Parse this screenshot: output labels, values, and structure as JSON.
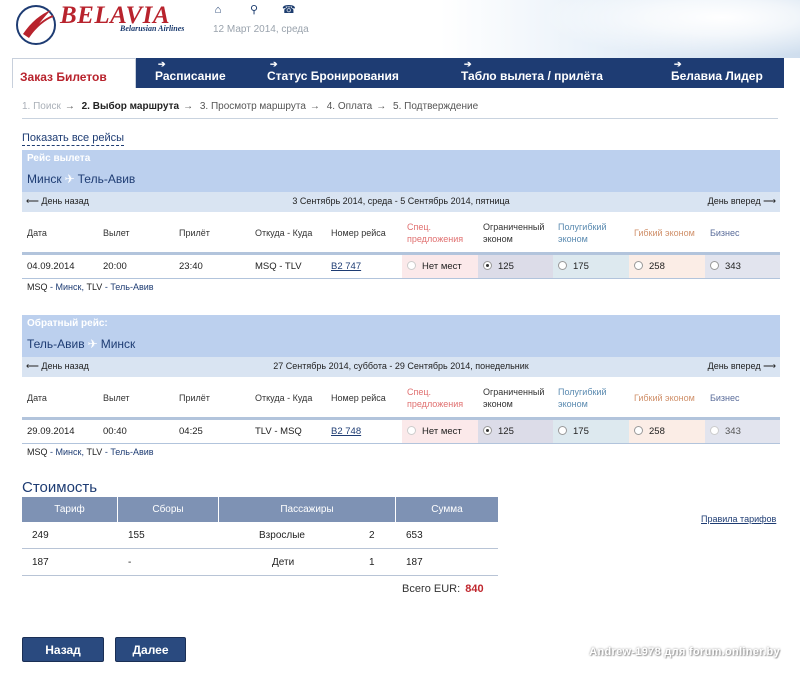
{
  "header": {
    "brand": "BELAVIA",
    "brand_sub": "Belarusian Airlines",
    "date": "12 Март 2014, среда",
    "icons": [
      "home-icon",
      "search-icon",
      "phone-icon"
    ]
  },
  "tabs": [
    {
      "label": "Заказ Билетов",
      "active": true
    },
    {
      "label": "Расписание"
    },
    {
      "label": "Статус Бронирования"
    },
    {
      "label": "Табло вылета / прилёта"
    },
    {
      "label": "Белавиа Лидер"
    }
  ],
  "steps": {
    "s1": "1. Поиск",
    "s2": "2. Выбор маршрута",
    "s3": "3. Просмотр маршрута",
    "s4": "4. Оплата",
    "s5": "5. Подтверждение",
    "arrow": "→"
  },
  "show_all": "Показать все рейсы",
  "columns": {
    "date": "Дата",
    "dep": "Вылет",
    "arr": "Прилёт",
    "from_to": "Откуда - Куда",
    "flight_no": "Номер рейса",
    "spec_1": "Спец.",
    "spec_2": "предложения",
    "ogr_1": "Ограниченный",
    "ogr_2": "эконом",
    "poluf_1": "Полугибкий",
    "poluf_2": "эконом",
    "gibk": "Гибкий эконом",
    "biz": "Бизнес"
  },
  "outbound": {
    "heading": "Рейс вылета",
    "from": "Минск",
    "to": "Тель-Авив",
    "prev": "⟵ День назад",
    "range": "3 Сентябрь 2014, среда - 5 Сентябрь 2014, пятница",
    "next": "День вперед ⟶",
    "row": {
      "date": "04.09.2014",
      "dep": "20:00",
      "arr": "23:40",
      "route": "MSQ - TLV",
      "flight": "B2 747",
      "spec": "Нет мест",
      "ogr": "125",
      "poluf": "175",
      "gibk": "258",
      "biz": "343"
    },
    "foot_a": "MSQ",
    "foot_a_city": "Минск",
    "foot_b": "TLV",
    "foot_b_city": "Тель-Авив"
  },
  "inbound": {
    "heading": "Обратный рейс:",
    "from": "Тель-Авив",
    "to": "Минск",
    "prev": "⟵ День назад",
    "range": "27 Сентябрь 2014, суббота - 29 Сентябрь 2014, понедельник",
    "next": "День вперед ⟶",
    "row": {
      "date": "29.09.2014",
      "dep": "00:40",
      "arr": "04:25",
      "route": "TLV - MSQ",
      "flight": "B2 748",
      "spec": "Нет мест",
      "ogr": "125",
      "poluf": "175",
      "gibk": "258",
      "biz": "343"
    },
    "foot_a": "MSQ",
    "foot_a_city": "Минск",
    "foot_b": "TLV",
    "foot_b_city": "Тель-Авив"
  },
  "cost": {
    "title": "Стоимость",
    "headers": [
      "Тариф",
      "Сборы",
      "Пассажиры",
      "Сумма"
    ],
    "rows": [
      {
        "tariff": "249",
        "fees": "155",
        "pax": "Взрослые",
        "count": "2",
        "sum": "653"
      },
      {
        "tariff": "187",
        "fees": "-",
        "pax": "Дети",
        "count": "1",
        "sum": "187"
      }
    ],
    "total_label": "Всего EUR:",
    "total_value": "840",
    "rules_link": "Правила тарифов"
  },
  "buttons": {
    "back": "Назад",
    "next": "Далее"
  },
  "watermark": "Andrew-1978 для forum.onliner.by",
  "colors": {
    "brand_red": "#b8232d",
    "navy": "#1e3c73",
    "header_blue": "#bcd0ee"
  }
}
